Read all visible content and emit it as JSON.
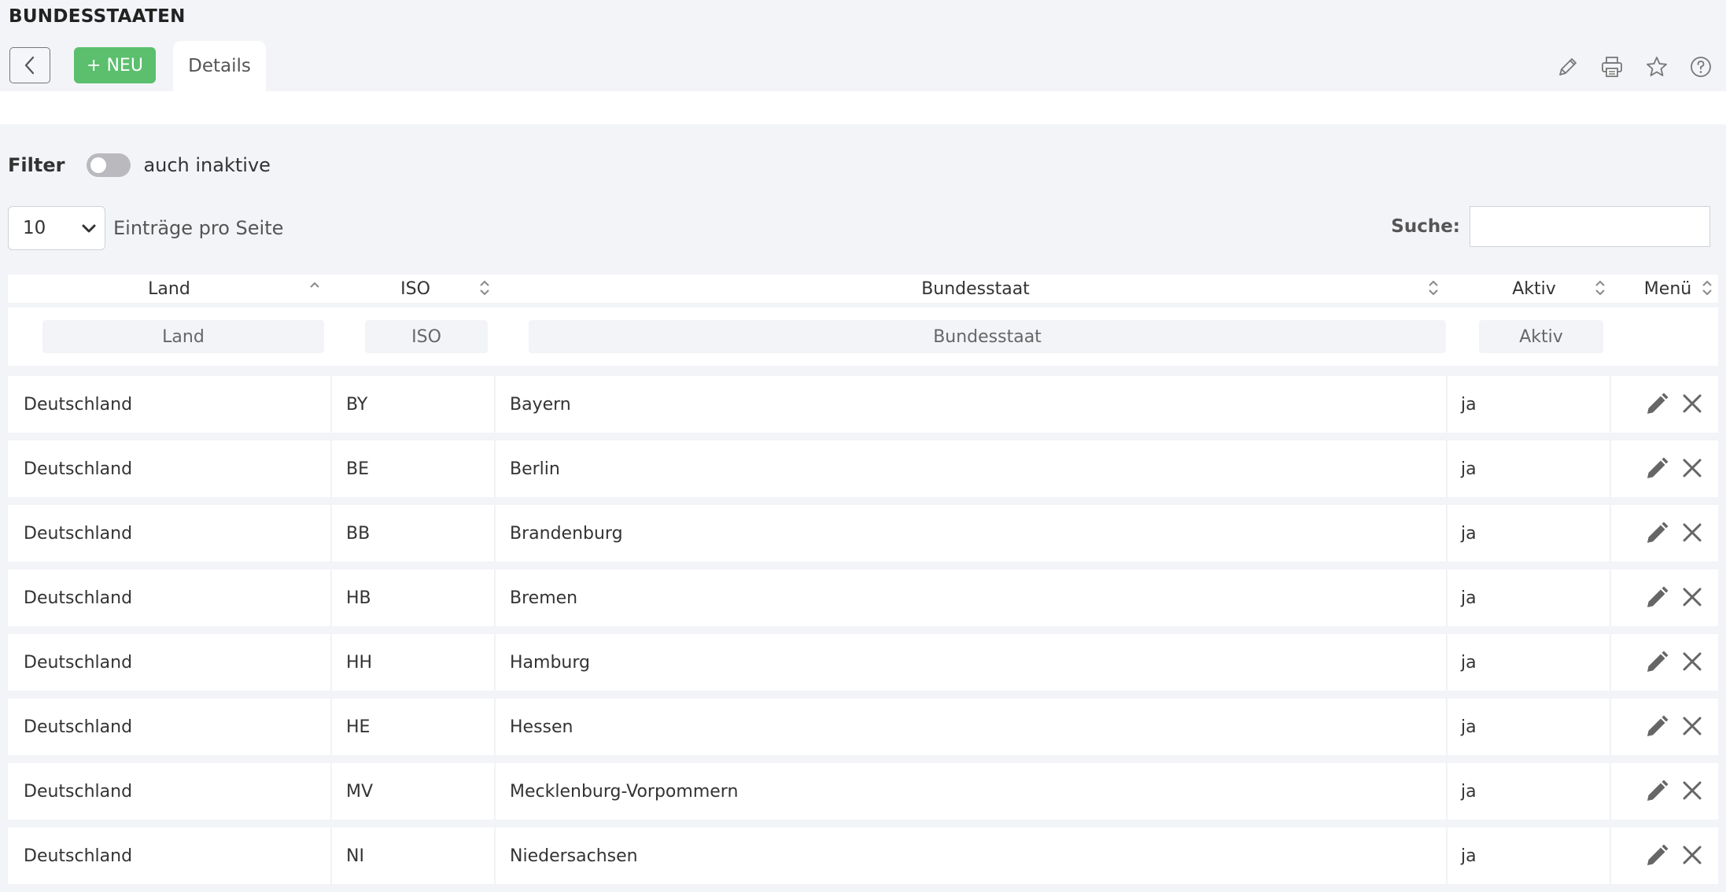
{
  "page": {
    "title": "BUNDESSTAATEN"
  },
  "toolbar": {
    "new_label": "+ NEU",
    "tab_details": "Details",
    "icons": [
      "pencil-icon",
      "printer-icon",
      "star-icon",
      "help-icon"
    ]
  },
  "filter": {
    "label": "Filter",
    "toggle_label": "auch inaktive",
    "toggle_on": false
  },
  "length": {
    "selected": "10",
    "label": "Einträge pro Seite"
  },
  "search": {
    "label": "Suche:",
    "value": ""
  },
  "table": {
    "columns": [
      "Land",
      "ISO",
      "Bundesstaat",
      "Aktiv",
      "Menü"
    ],
    "filters": [
      "Land",
      "ISO",
      "Bundesstaat",
      "Aktiv"
    ],
    "rows": [
      {
        "land": "Deutschland",
        "iso": "BY",
        "staat": "Bayern",
        "aktiv": "ja"
      },
      {
        "land": "Deutschland",
        "iso": "BE",
        "staat": "Berlin",
        "aktiv": "ja"
      },
      {
        "land": "Deutschland",
        "iso": "BB",
        "staat": "Brandenburg",
        "aktiv": "ja"
      },
      {
        "land": "Deutschland",
        "iso": "HB",
        "staat": "Bremen",
        "aktiv": "ja"
      },
      {
        "land": "Deutschland",
        "iso": "HH",
        "staat": "Hamburg",
        "aktiv": "ja"
      },
      {
        "land": "Deutschland",
        "iso": "HE",
        "staat": "Hessen",
        "aktiv": "ja"
      },
      {
        "land": "Deutschland",
        "iso": "MV",
        "staat": "Mecklenburg-Vorpommern",
        "aktiv": "ja"
      },
      {
        "land": "Deutschland",
        "iso": "NI",
        "staat": "Niedersachsen",
        "aktiv": "ja"
      }
    ]
  }
}
